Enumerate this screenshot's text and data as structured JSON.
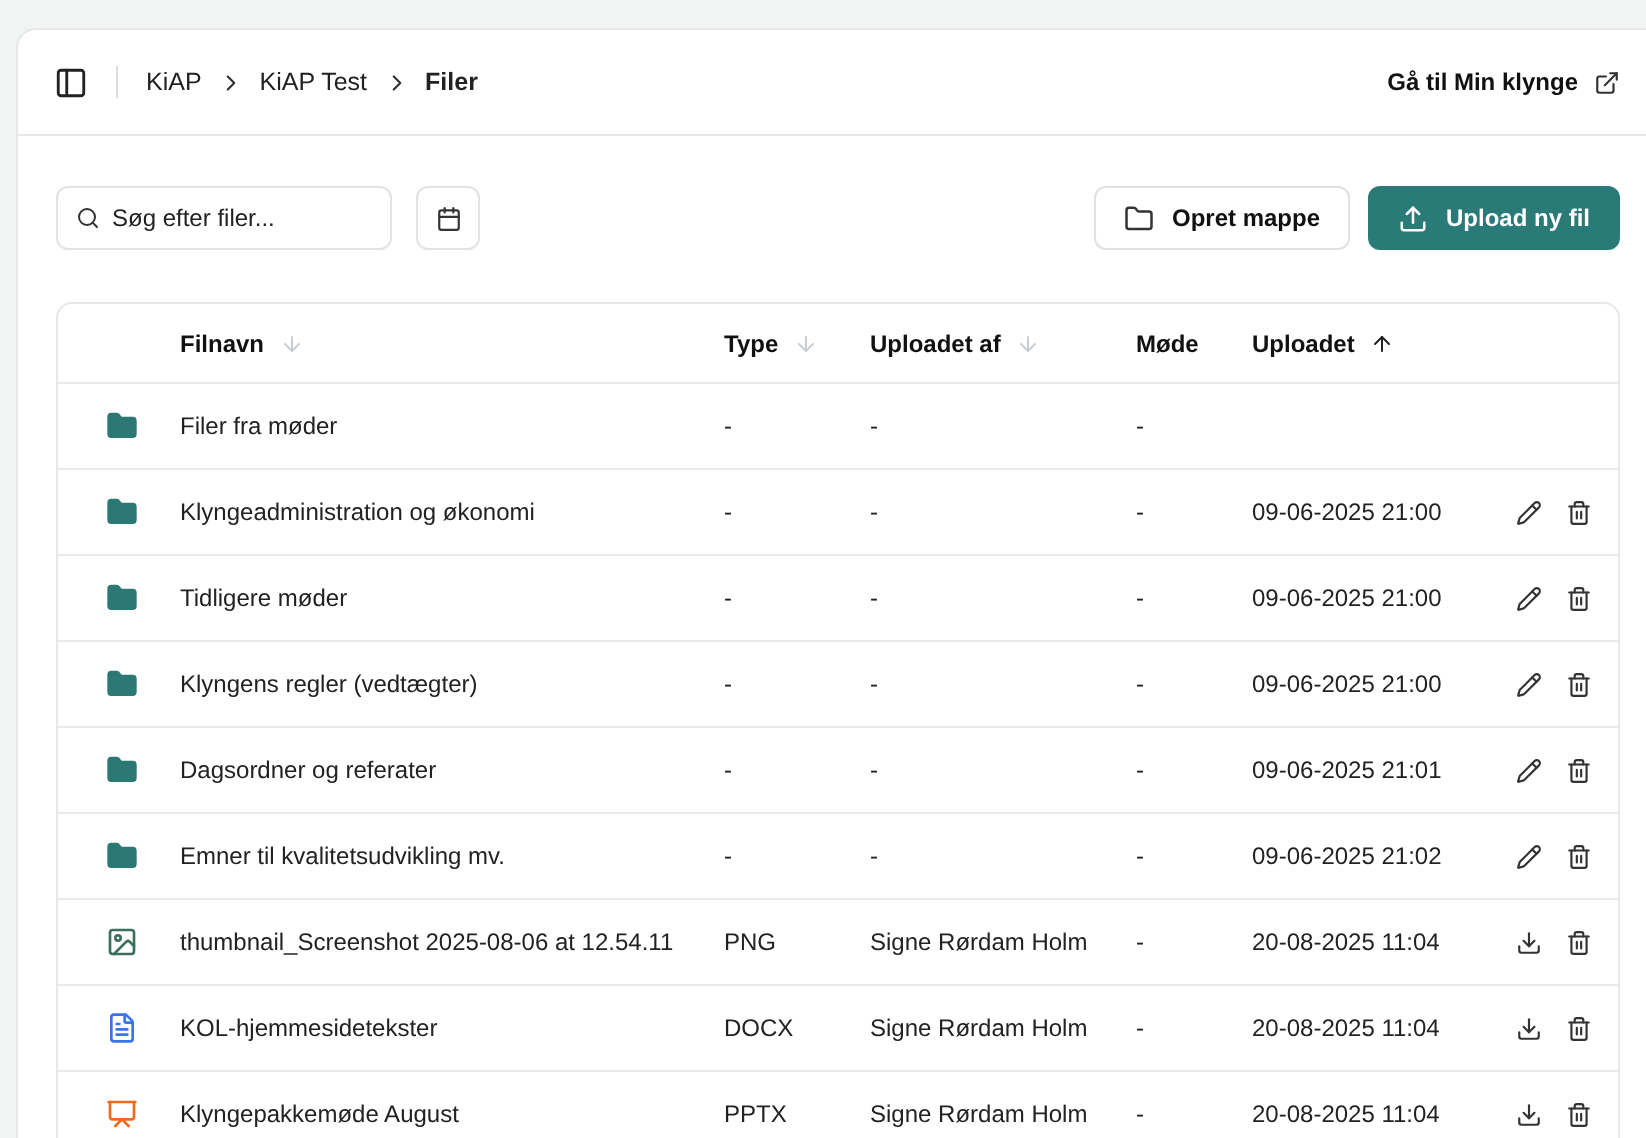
{
  "breadcrumbs": [
    {
      "label": "KiAP",
      "current": false
    },
    {
      "label": "KiAP Test",
      "current": false
    },
    {
      "label": "Filer",
      "current": true
    }
  ],
  "header_link": "Gå til Min klynge",
  "search": {
    "placeholder": "Søg efter filer..."
  },
  "buttons": [
    {
      "label": "Opret mappe",
      "kind": "secondary"
    },
    {
      "label": "Upload ny fil",
      "kind": "primary"
    }
  ],
  "table": {
    "columns": [
      {
        "label": "Filnavn",
        "sortable": true,
        "sorted": false
      },
      {
        "label": "Type",
        "sortable": true,
        "sorted": false
      },
      {
        "label": "Uploadet af",
        "sortable": true,
        "sorted": false
      },
      {
        "label": "Møde",
        "sortable": false,
        "sorted": false
      },
      {
        "label": "Uploadet",
        "sortable": true,
        "sorted": true
      }
    ],
    "rows": [
      {
        "kind": "folder",
        "name": "Filer fra møder",
        "type": "-",
        "uploaded_by": "-",
        "meeting": "-",
        "uploaded": "",
        "editable": false,
        "downloadable": false,
        "deletable": false
      },
      {
        "kind": "folder",
        "name": "Klyngeadministration og økonomi",
        "type": "-",
        "uploaded_by": "-",
        "meeting": "-",
        "uploaded": "09-06-2025 21:00",
        "editable": true,
        "downloadable": false,
        "deletable": true
      },
      {
        "kind": "folder",
        "name": "Tidligere møder",
        "type": "-",
        "uploaded_by": "-",
        "meeting": "-",
        "uploaded": "09-06-2025 21:00",
        "editable": true,
        "downloadable": false,
        "deletable": true
      },
      {
        "kind": "folder",
        "name": "Klyngens regler (vedtægter)",
        "type": "-",
        "uploaded_by": "-",
        "meeting": "-",
        "uploaded": "09-06-2025 21:00",
        "editable": true,
        "downloadable": false,
        "deletable": true
      },
      {
        "kind": "folder",
        "name": "Dagsordner og referater",
        "type": "-",
        "uploaded_by": "-",
        "meeting": "-",
        "uploaded": "09-06-2025 21:01",
        "editable": true,
        "downloadable": false,
        "deletable": true
      },
      {
        "kind": "folder",
        "name": "Emner til kvalitetsudvikling mv.",
        "type": "-",
        "uploaded_by": "-",
        "meeting": "-",
        "uploaded": "09-06-2025 21:02",
        "editable": true,
        "downloadable": false,
        "deletable": true
      },
      {
        "kind": "image",
        "name": "thumbnail_Screenshot 2025-08-06 at 12.54.11",
        "type": "PNG",
        "uploaded_by": "Signe Rørdam Holm",
        "meeting": "-",
        "uploaded": "20-08-2025 11:04",
        "editable": false,
        "downloadable": true,
        "deletable": true
      },
      {
        "kind": "document",
        "name": "KOL-hjemmesidetekster",
        "type": "DOCX",
        "uploaded_by": "Signe Rørdam Holm",
        "meeting": "-",
        "uploaded": "20-08-2025 11:04",
        "editable": false,
        "downloadable": true,
        "deletable": true
      },
      {
        "kind": "presentation",
        "name": "Klyngepakkemøde August",
        "type": "PPTX",
        "uploaded_by": "Signe Rørdam Holm",
        "meeting": "-",
        "uploaded": "20-08-2025 11:04",
        "editable": false,
        "downloadable": true,
        "deletable": true
      }
    ]
  }
}
